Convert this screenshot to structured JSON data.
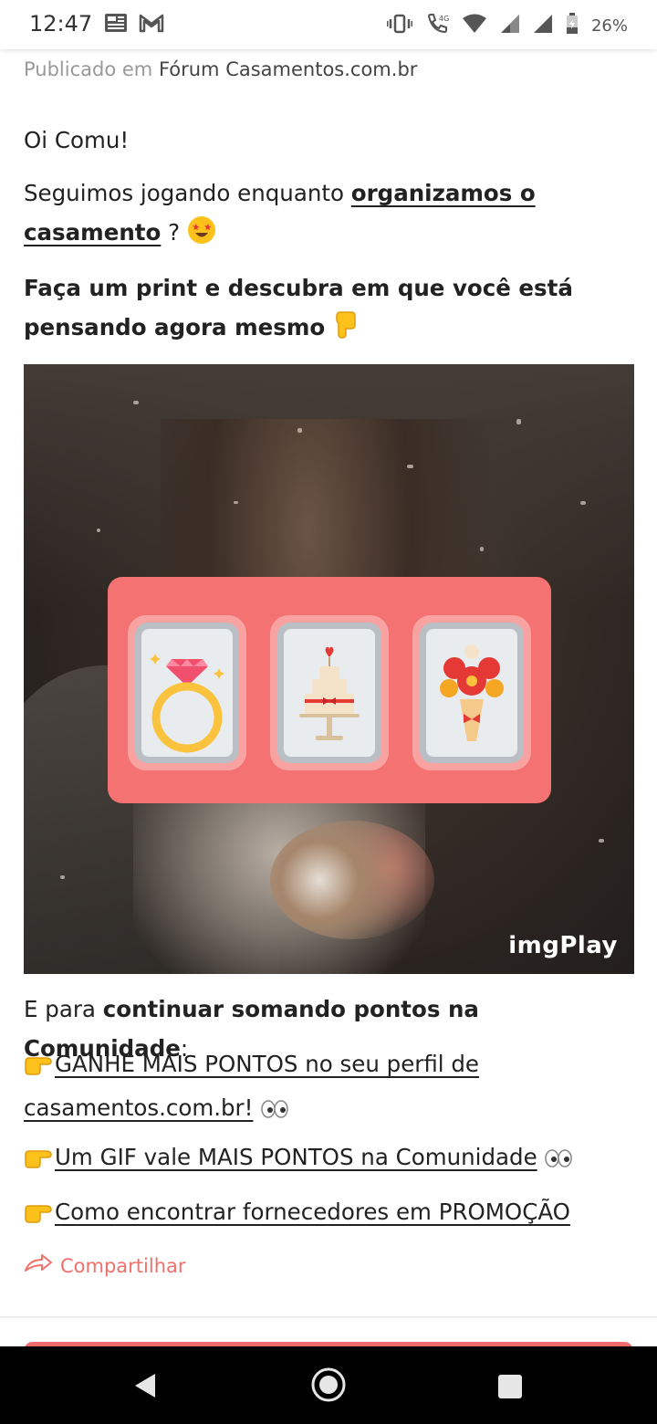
{
  "status_bar": {
    "time": "12:47",
    "battery": "26%",
    "network": "4G",
    "icons": [
      "news-icon",
      "gmail-icon",
      "vibrate-icon",
      "wifi-call-icon",
      "wifi-icon",
      "signal-icon",
      "signal-icon",
      "battery-icon"
    ]
  },
  "post": {
    "published_prefix": "Publicado em",
    "published_forum": "Fórum Casamentos.com.br",
    "greeting": "Oi Comu!",
    "line1_text": "Seguimos jogando enquanto ",
    "line1_link": "organizamos o casamento",
    "line1_suffix": " ?",
    "line2": "Faça um print e descubra em que você está pensando agora mesmo",
    "image_watermark": "imgPlay",
    "slot_items": [
      "ring-icon",
      "cake-icon",
      "bouquet-icon"
    ],
    "cta_prefix": "E para ",
    "cta_bold": "continuar somando pontos na Comunidade",
    "cta_suffix": ":",
    "links": [
      {
        "text": "GANHE MAIS PONTOS no seu perfil de casamentos.com.br!"
      },
      {
        "text": "Um GIF vale MAIS PONTOS na Comunidade"
      },
      {
        "text": "Como encontrar fornecedores em PROMOÇÃO"
      }
    ],
    "share_label": "Compartilhar"
  },
  "colors": {
    "accent": "#f0706c",
    "slot_bg": "#f47372",
    "text": "#222222"
  }
}
